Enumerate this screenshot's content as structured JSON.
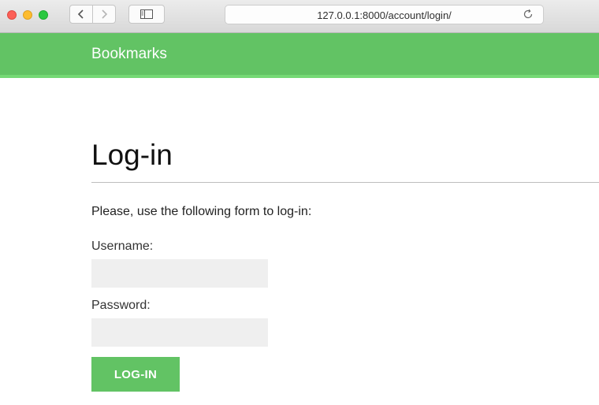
{
  "browser": {
    "url": "127.0.0.1:8000/account/login/",
    "icons": {
      "back": "chevron-left-icon",
      "forward": "chevron-right-icon",
      "sidebar": "sidebar-icon",
      "reload": "reload-icon"
    }
  },
  "header": {
    "brand": "Bookmarks",
    "color": "#62c364"
  },
  "page": {
    "title": "Log-in",
    "intro": "Please, use the following form to log-in:"
  },
  "form": {
    "username_label": "Username:",
    "username_value": "",
    "password_label": "Password:",
    "password_value": "",
    "submit_label": "LOG-IN"
  }
}
